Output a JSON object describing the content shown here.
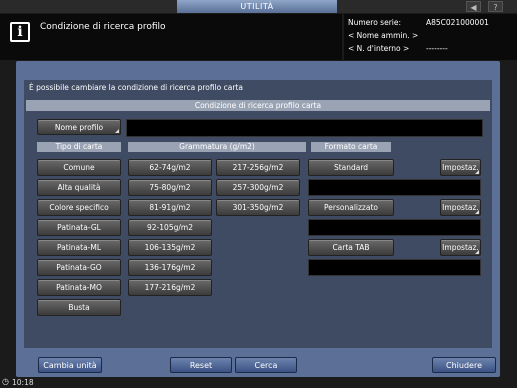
{
  "window": {
    "top_tab": "UTILITÀ",
    "top_icons": [
      "speaker-icon",
      "help-icon"
    ]
  },
  "header": {
    "title": "Condizione di ricerca profilo",
    "serial_label": "Numero serie:",
    "serial_value": "A85C021000001",
    "admin_name": "< Nome ammin. >",
    "internal_no": "< N. d'interno >",
    "internal_value": "--------"
  },
  "main": {
    "message": "È possibile cambiare la condizione di ricerca profilo carta",
    "section_title": "Condizione di ricerca profilo carta",
    "profile_name_button": "Nome profilo",
    "profile_name_value": "",
    "paper_type_header": "Tipo di carta",
    "paper_types": [
      "Comune",
      "Alta qualità",
      "Colore specifico",
      "Patinata-GL",
      "Patinata-ML",
      "Patinata-GO",
      "Patinata-MO",
      "Busta"
    ],
    "weight_header": "Grammatura (g/m2)",
    "weights_col1": [
      "62-74g/m2",
      "75-80g/m2",
      "81-91g/m2",
      "92-105g/m2",
      "106-135g/m2",
      "136-176g/m2",
      "177-216g/m2"
    ],
    "weights_col2": [
      "217-256g/m2",
      "257-300g/m2",
      "301-350g/m2"
    ],
    "format_header": "Formato carta",
    "formats": [
      "Standard",
      "Personalizzato",
      "Carta TAB"
    ],
    "settings_label": "Impostaz."
  },
  "footer": {
    "change_unit": "Cambia unità",
    "reset": "Reset",
    "search": "Cerca",
    "close": "Chiudere"
  },
  "status": {
    "time": "10:18"
  }
}
